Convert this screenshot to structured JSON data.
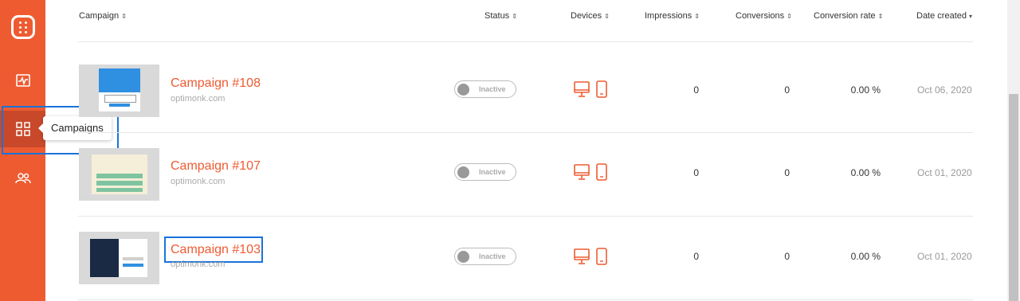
{
  "sidebar": {
    "tooltip": "Campaigns",
    "items": [
      {
        "name": "analytics-icon"
      },
      {
        "name": "campaigns-grid-icon"
      },
      {
        "name": "users-icon"
      }
    ]
  },
  "table": {
    "headers": {
      "campaign": "Campaign",
      "status": "Status",
      "devices": "Devices",
      "impressions": "Impressions",
      "conversions": "Conversions",
      "conversion_rate": "Conversion rate",
      "date_created": "Date created"
    },
    "rows": [
      {
        "name": "Campaign #108",
        "domain": "optimonk.com",
        "status": "Inactive",
        "impressions": "0",
        "conversions": "0",
        "rate": "0.00 %",
        "date": "Oct 06, 2020"
      },
      {
        "name": "Campaign #107",
        "domain": "optimonk.com",
        "status": "Inactive",
        "impressions": "0",
        "conversions": "0",
        "rate": "0.00 %",
        "date": "Oct 01, 2020"
      },
      {
        "name": "Campaign #103",
        "domain": "optimonk.com",
        "status": "Inactive",
        "impressions": "0",
        "conversions": "0",
        "rate": "0.00 %",
        "date": "Oct 01, 2020"
      }
    ]
  },
  "colors": {
    "brand": "#ee5b31",
    "highlight": "#1a73d9"
  }
}
